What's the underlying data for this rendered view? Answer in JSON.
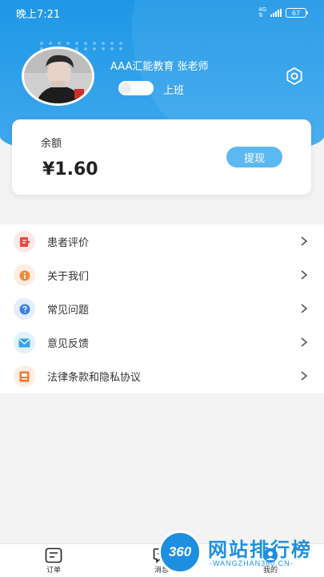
{
  "status_bar": {
    "time": "晚上7:21",
    "network_label": "4G",
    "battery": "67"
  },
  "profile": {
    "name": "AAA汇能教育 张老师",
    "toggle_label": "上班",
    "toggle_on": false
  },
  "balance": {
    "label": "余额",
    "amount": "¥1.60",
    "withdraw_label": "提现"
  },
  "menu": [
    {
      "label": "患者评价",
      "icon": "review-icon",
      "color": "#e5483e",
      "bg": "#fde8e6"
    },
    {
      "label": "关于我们",
      "icon": "info-icon",
      "color": "#f08a3c",
      "bg": "#fdeee1"
    },
    {
      "label": "常见问题",
      "icon": "question-icon",
      "color": "#3d7fe0",
      "bg": "#e3edfb"
    },
    {
      "label": "意见反馈",
      "icon": "mail-icon",
      "color": "#3aa3e6",
      "bg": "#e1f1fb"
    },
    {
      "label": "法律条款和隐私协议",
      "icon": "document-icon",
      "color": "#ee7b37",
      "bg": "#fdeee1"
    }
  ],
  "tabbar": {
    "tabs": [
      {
        "label": "订单",
        "icon": "order-icon"
      },
      {
        "label": "消息",
        "icon": "message-icon"
      },
      {
        "label": "我的",
        "icon": "profile-icon"
      }
    ]
  },
  "watermark": {
    "logo_text": "360",
    "title": "网站排行榜",
    "subtitle": "-WANGZHAN360.CN-"
  }
}
